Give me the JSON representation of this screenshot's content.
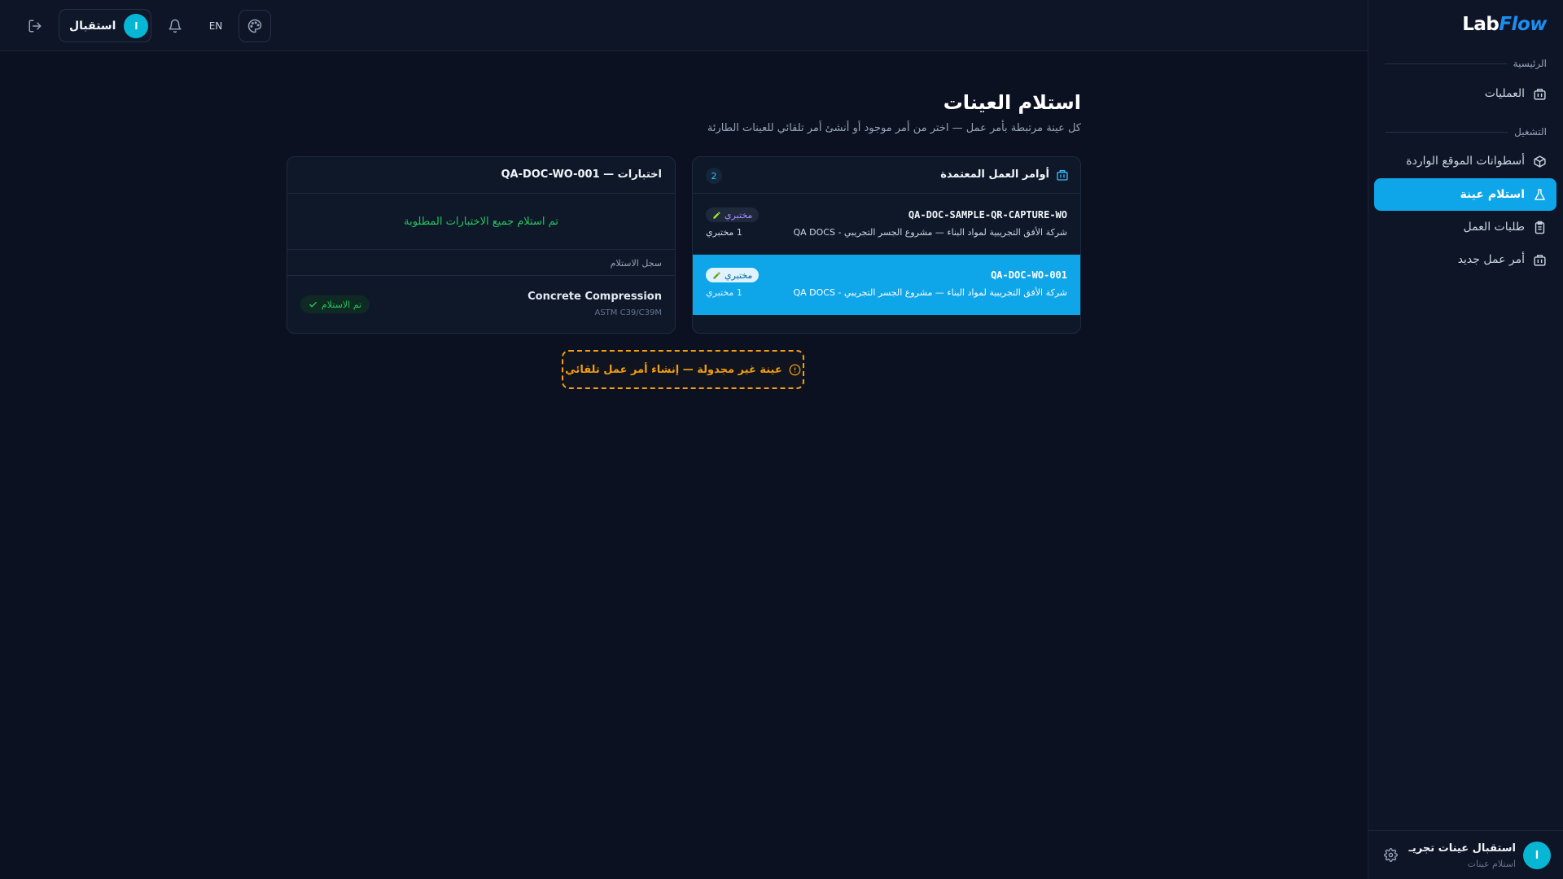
{
  "app": {
    "logo_lab": "Lab",
    "logo_flow": "Flow"
  },
  "topbar": {
    "user_label": "استقبال",
    "user_initial": "ا",
    "language": "EN",
    "icons": [
      "logout-icon",
      "bell-icon",
      "palette-icon"
    ]
  },
  "sidebar": {
    "section_home": "الرئيسية",
    "item_operations": "العمليات",
    "section_run": "التشغيل",
    "items": [
      {
        "label": "أسطوانات الموقع الواردة",
        "icon": "cube-icon"
      },
      {
        "label": "استلام عينة",
        "icon": "flask-icon",
        "active": true
      },
      {
        "label": "طلبات العمل",
        "icon": "clipboard-icon"
      },
      {
        "label": "أمر عمل جديد",
        "icon": "building-icon"
      }
    ],
    "footer": {
      "initial": "ا",
      "name": "استقبال عينات تجريـ",
      "role": "استلام عينات"
    }
  },
  "page": {
    "title": "استلام العينات",
    "subtitle": "كل عينة مرتبطة بأمر عمل — اختر من أمر موجود أو أنشئ أمر تلقائي للعينات الطارئة"
  },
  "work_orders": {
    "title": "أوامر العمل المعتمدة",
    "count": "2",
    "rows": [
      {
        "code": "QA-DOC-SAMPLE-QR-CAPTURE-WO",
        "client": "شركة الأفق التجريبية لمواد البناء — مشروع الجسر التجريبي - QA DOCS",
        "pill": "مختبري",
        "labs": "1 مختبري",
        "selected": false
      },
      {
        "code": "QA-DOC-WO-001",
        "client": "شركة الأفق التجريبية لمواد البناء — مشروع الجسر التجريبي - QA DOCS",
        "pill": "مختبري",
        "labs": "1 مختبري",
        "selected": true
      }
    ]
  },
  "tests": {
    "title": "اختبارات — QA-DOC-WO-001",
    "all_received": "تم استلام جميع الاختبارات المطلوبة",
    "log_label": "سجل الاستلام",
    "log": [
      {
        "name": "Concrete Compression",
        "standard": "ASTM C39/C39M",
        "status": "تم الاستلام"
      }
    ]
  },
  "actions": {
    "unscheduled": "عينة غير مجدولة — إنشاء أمر عمل تلقائي"
  },
  "colors": {
    "accent": "#0ea5e9",
    "success": "#22c55e",
    "warning": "#f59e0b",
    "bg": "#0b1120"
  }
}
